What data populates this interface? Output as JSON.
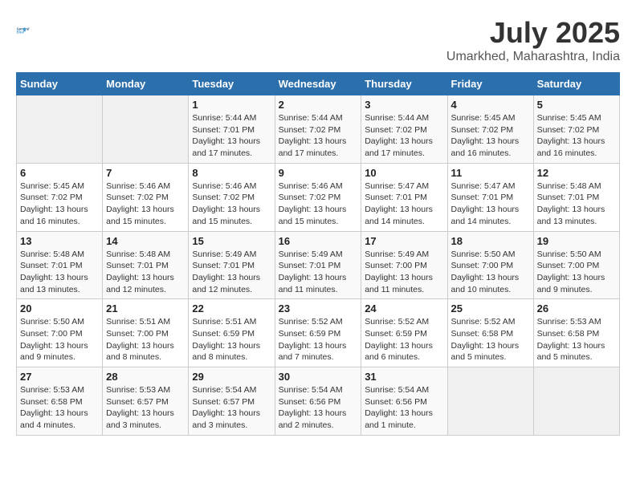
{
  "header": {
    "logo_line1": "General",
    "logo_line2": "Blue",
    "title": "July 2025",
    "subtitle": "Umarkhed, Maharashtra, India"
  },
  "columns": [
    "Sunday",
    "Monday",
    "Tuesday",
    "Wednesday",
    "Thursday",
    "Friday",
    "Saturday"
  ],
  "weeks": [
    {
      "days": [
        {
          "num": "",
          "info": "",
          "empty": true
        },
        {
          "num": "",
          "info": "",
          "empty": true
        },
        {
          "num": "1",
          "info": "Sunrise: 5:44 AM\nSunset: 7:01 PM\nDaylight: 13 hours\nand 17 minutes."
        },
        {
          "num": "2",
          "info": "Sunrise: 5:44 AM\nSunset: 7:02 PM\nDaylight: 13 hours\nand 17 minutes."
        },
        {
          "num": "3",
          "info": "Sunrise: 5:44 AM\nSunset: 7:02 PM\nDaylight: 13 hours\nand 17 minutes."
        },
        {
          "num": "4",
          "info": "Sunrise: 5:45 AM\nSunset: 7:02 PM\nDaylight: 13 hours\nand 16 minutes."
        },
        {
          "num": "5",
          "info": "Sunrise: 5:45 AM\nSunset: 7:02 PM\nDaylight: 13 hours\nand 16 minutes."
        }
      ]
    },
    {
      "days": [
        {
          "num": "6",
          "info": "Sunrise: 5:45 AM\nSunset: 7:02 PM\nDaylight: 13 hours\nand 16 minutes."
        },
        {
          "num": "7",
          "info": "Sunrise: 5:46 AM\nSunset: 7:02 PM\nDaylight: 13 hours\nand 15 minutes."
        },
        {
          "num": "8",
          "info": "Sunrise: 5:46 AM\nSunset: 7:02 PM\nDaylight: 13 hours\nand 15 minutes."
        },
        {
          "num": "9",
          "info": "Sunrise: 5:46 AM\nSunset: 7:02 PM\nDaylight: 13 hours\nand 15 minutes."
        },
        {
          "num": "10",
          "info": "Sunrise: 5:47 AM\nSunset: 7:01 PM\nDaylight: 13 hours\nand 14 minutes."
        },
        {
          "num": "11",
          "info": "Sunrise: 5:47 AM\nSunset: 7:01 PM\nDaylight: 13 hours\nand 14 minutes."
        },
        {
          "num": "12",
          "info": "Sunrise: 5:48 AM\nSunset: 7:01 PM\nDaylight: 13 hours\nand 13 minutes."
        }
      ]
    },
    {
      "days": [
        {
          "num": "13",
          "info": "Sunrise: 5:48 AM\nSunset: 7:01 PM\nDaylight: 13 hours\nand 13 minutes."
        },
        {
          "num": "14",
          "info": "Sunrise: 5:48 AM\nSunset: 7:01 PM\nDaylight: 13 hours\nand 12 minutes."
        },
        {
          "num": "15",
          "info": "Sunrise: 5:49 AM\nSunset: 7:01 PM\nDaylight: 13 hours\nand 12 minutes."
        },
        {
          "num": "16",
          "info": "Sunrise: 5:49 AM\nSunset: 7:01 PM\nDaylight: 13 hours\nand 11 minutes."
        },
        {
          "num": "17",
          "info": "Sunrise: 5:49 AM\nSunset: 7:00 PM\nDaylight: 13 hours\nand 11 minutes."
        },
        {
          "num": "18",
          "info": "Sunrise: 5:50 AM\nSunset: 7:00 PM\nDaylight: 13 hours\nand 10 minutes."
        },
        {
          "num": "19",
          "info": "Sunrise: 5:50 AM\nSunset: 7:00 PM\nDaylight: 13 hours\nand 9 minutes."
        }
      ]
    },
    {
      "days": [
        {
          "num": "20",
          "info": "Sunrise: 5:50 AM\nSunset: 7:00 PM\nDaylight: 13 hours\nand 9 minutes."
        },
        {
          "num": "21",
          "info": "Sunrise: 5:51 AM\nSunset: 7:00 PM\nDaylight: 13 hours\nand 8 minutes."
        },
        {
          "num": "22",
          "info": "Sunrise: 5:51 AM\nSunset: 6:59 PM\nDaylight: 13 hours\nand 8 minutes."
        },
        {
          "num": "23",
          "info": "Sunrise: 5:52 AM\nSunset: 6:59 PM\nDaylight: 13 hours\nand 7 minutes."
        },
        {
          "num": "24",
          "info": "Sunrise: 5:52 AM\nSunset: 6:59 PM\nDaylight: 13 hours\nand 6 minutes."
        },
        {
          "num": "25",
          "info": "Sunrise: 5:52 AM\nSunset: 6:58 PM\nDaylight: 13 hours\nand 5 minutes."
        },
        {
          "num": "26",
          "info": "Sunrise: 5:53 AM\nSunset: 6:58 PM\nDaylight: 13 hours\nand 5 minutes."
        }
      ]
    },
    {
      "days": [
        {
          "num": "27",
          "info": "Sunrise: 5:53 AM\nSunset: 6:58 PM\nDaylight: 13 hours\nand 4 minutes."
        },
        {
          "num": "28",
          "info": "Sunrise: 5:53 AM\nSunset: 6:57 PM\nDaylight: 13 hours\nand 3 minutes."
        },
        {
          "num": "29",
          "info": "Sunrise: 5:54 AM\nSunset: 6:57 PM\nDaylight: 13 hours\nand 3 minutes."
        },
        {
          "num": "30",
          "info": "Sunrise: 5:54 AM\nSunset: 6:56 PM\nDaylight: 13 hours\nand 2 minutes."
        },
        {
          "num": "31",
          "info": "Sunrise: 5:54 AM\nSunset: 6:56 PM\nDaylight: 13 hours\nand 1 minute."
        },
        {
          "num": "",
          "info": "",
          "empty": true
        },
        {
          "num": "",
          "info": "",
          "empty": true
        }
      ]
    }
  ]
}
